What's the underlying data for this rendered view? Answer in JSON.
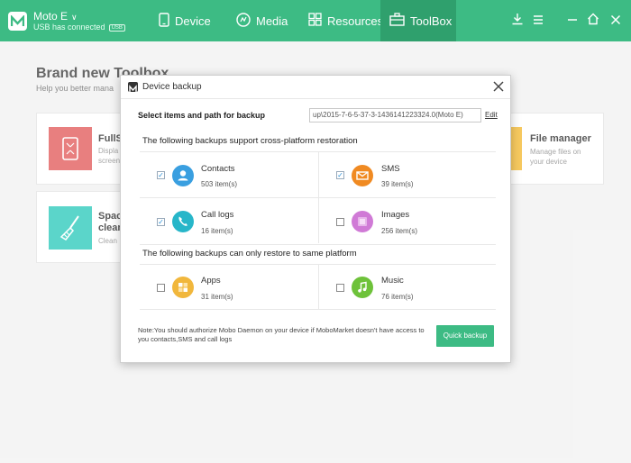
{
  "topbar": {
    "device_name": "Moto E",
    "device_status": "USB has connected",
    "usb_badge": "USB",
    "tabs": [
      {
        "label": "Device",
        "icon": "device-icon"
      },
      {
        "label": "Media",
        "icon": "media-icon"
      },
      {
        "label": "Resources",
        "icon": "resources-icon"
      },
      {
        "label": "ToolBox",
        "icon": "toolbox-icon",
        "active": true
      }
    ],
    "window_buttons": [
      "download-icon",
      "menu-icon",
      "minimize-icon",
      "home-icon",
      "close-icon"
    ]
  },
  "background": {
    "title": "Brand new Toolbox",
    "subtitle": "Help you better mana",
    "cards": [
      {
        "title": "FullS",
        "desc": "Displa\nscreen",
        "icon": "fullscreen-icon",
        "color": "#e05454"
      },
      {
        "title": "File manager",
        "desc": "Manage files on\nyour device",
        "icon": "folder-icon",
        "color": "#f5b72a"
      },
      {
        "title": "Spac\nclean",
        "desc": "Clean",
        "icon": "broom-icon",
        "color": "#25c7b8"
      }
    ]
  },
  "dialog": {
    "title": "Device backup",
    "select_label": "Select items and path for backup",
    "path_value": "up\\2015-7-6-5-37-3-1436141223324.0(Moto E)",
    "edit_label": "Edit",
    "section_cross": "The following backups support cross-platform restoration",
    "section_same": "The following backups can only restore to same platform",
    "items": {
      "contacts": {
        "name": "Contacts",
        "count": "503 item(s)",
        "checked": true,
        "color": "#3a9fe0"
      },
      "sms": {
        "name": "SMS",
        "count": "39 item(s)",
        "checked": true,
        "color": "#f08a22"
      },
      "call_logs": {
        "name": "Call logs",
        "count": "16 item(s)",
        "checked": true,
        "color": "#27b6c9"
      },
      "images": {
        "name": "Images",
        "count": "256 item(s)",
        "checked": false,
        "color": "#d07ad6"
      },
      "apps": {
        "name": "Apps",
        "count": "31 item(s)",
        "checked": false,
        "color": "#f1b73c"
      },
      "music": {
        "name": "Music",
        "count": "76 item(s)",
        "checked": false,
        "color": "#6ec23a"
      }
    },
    "note": "Note:You should authorize Mobo Daemon on your device if MoboMarket doesn't have access to you contacts,SMS and call logs",
    "quick_backup_label": "Quick backup"
  },
  "colors": {
    "accent": "#3dbb84",
    "accent_dark": "#2fa06d"
  }
}
